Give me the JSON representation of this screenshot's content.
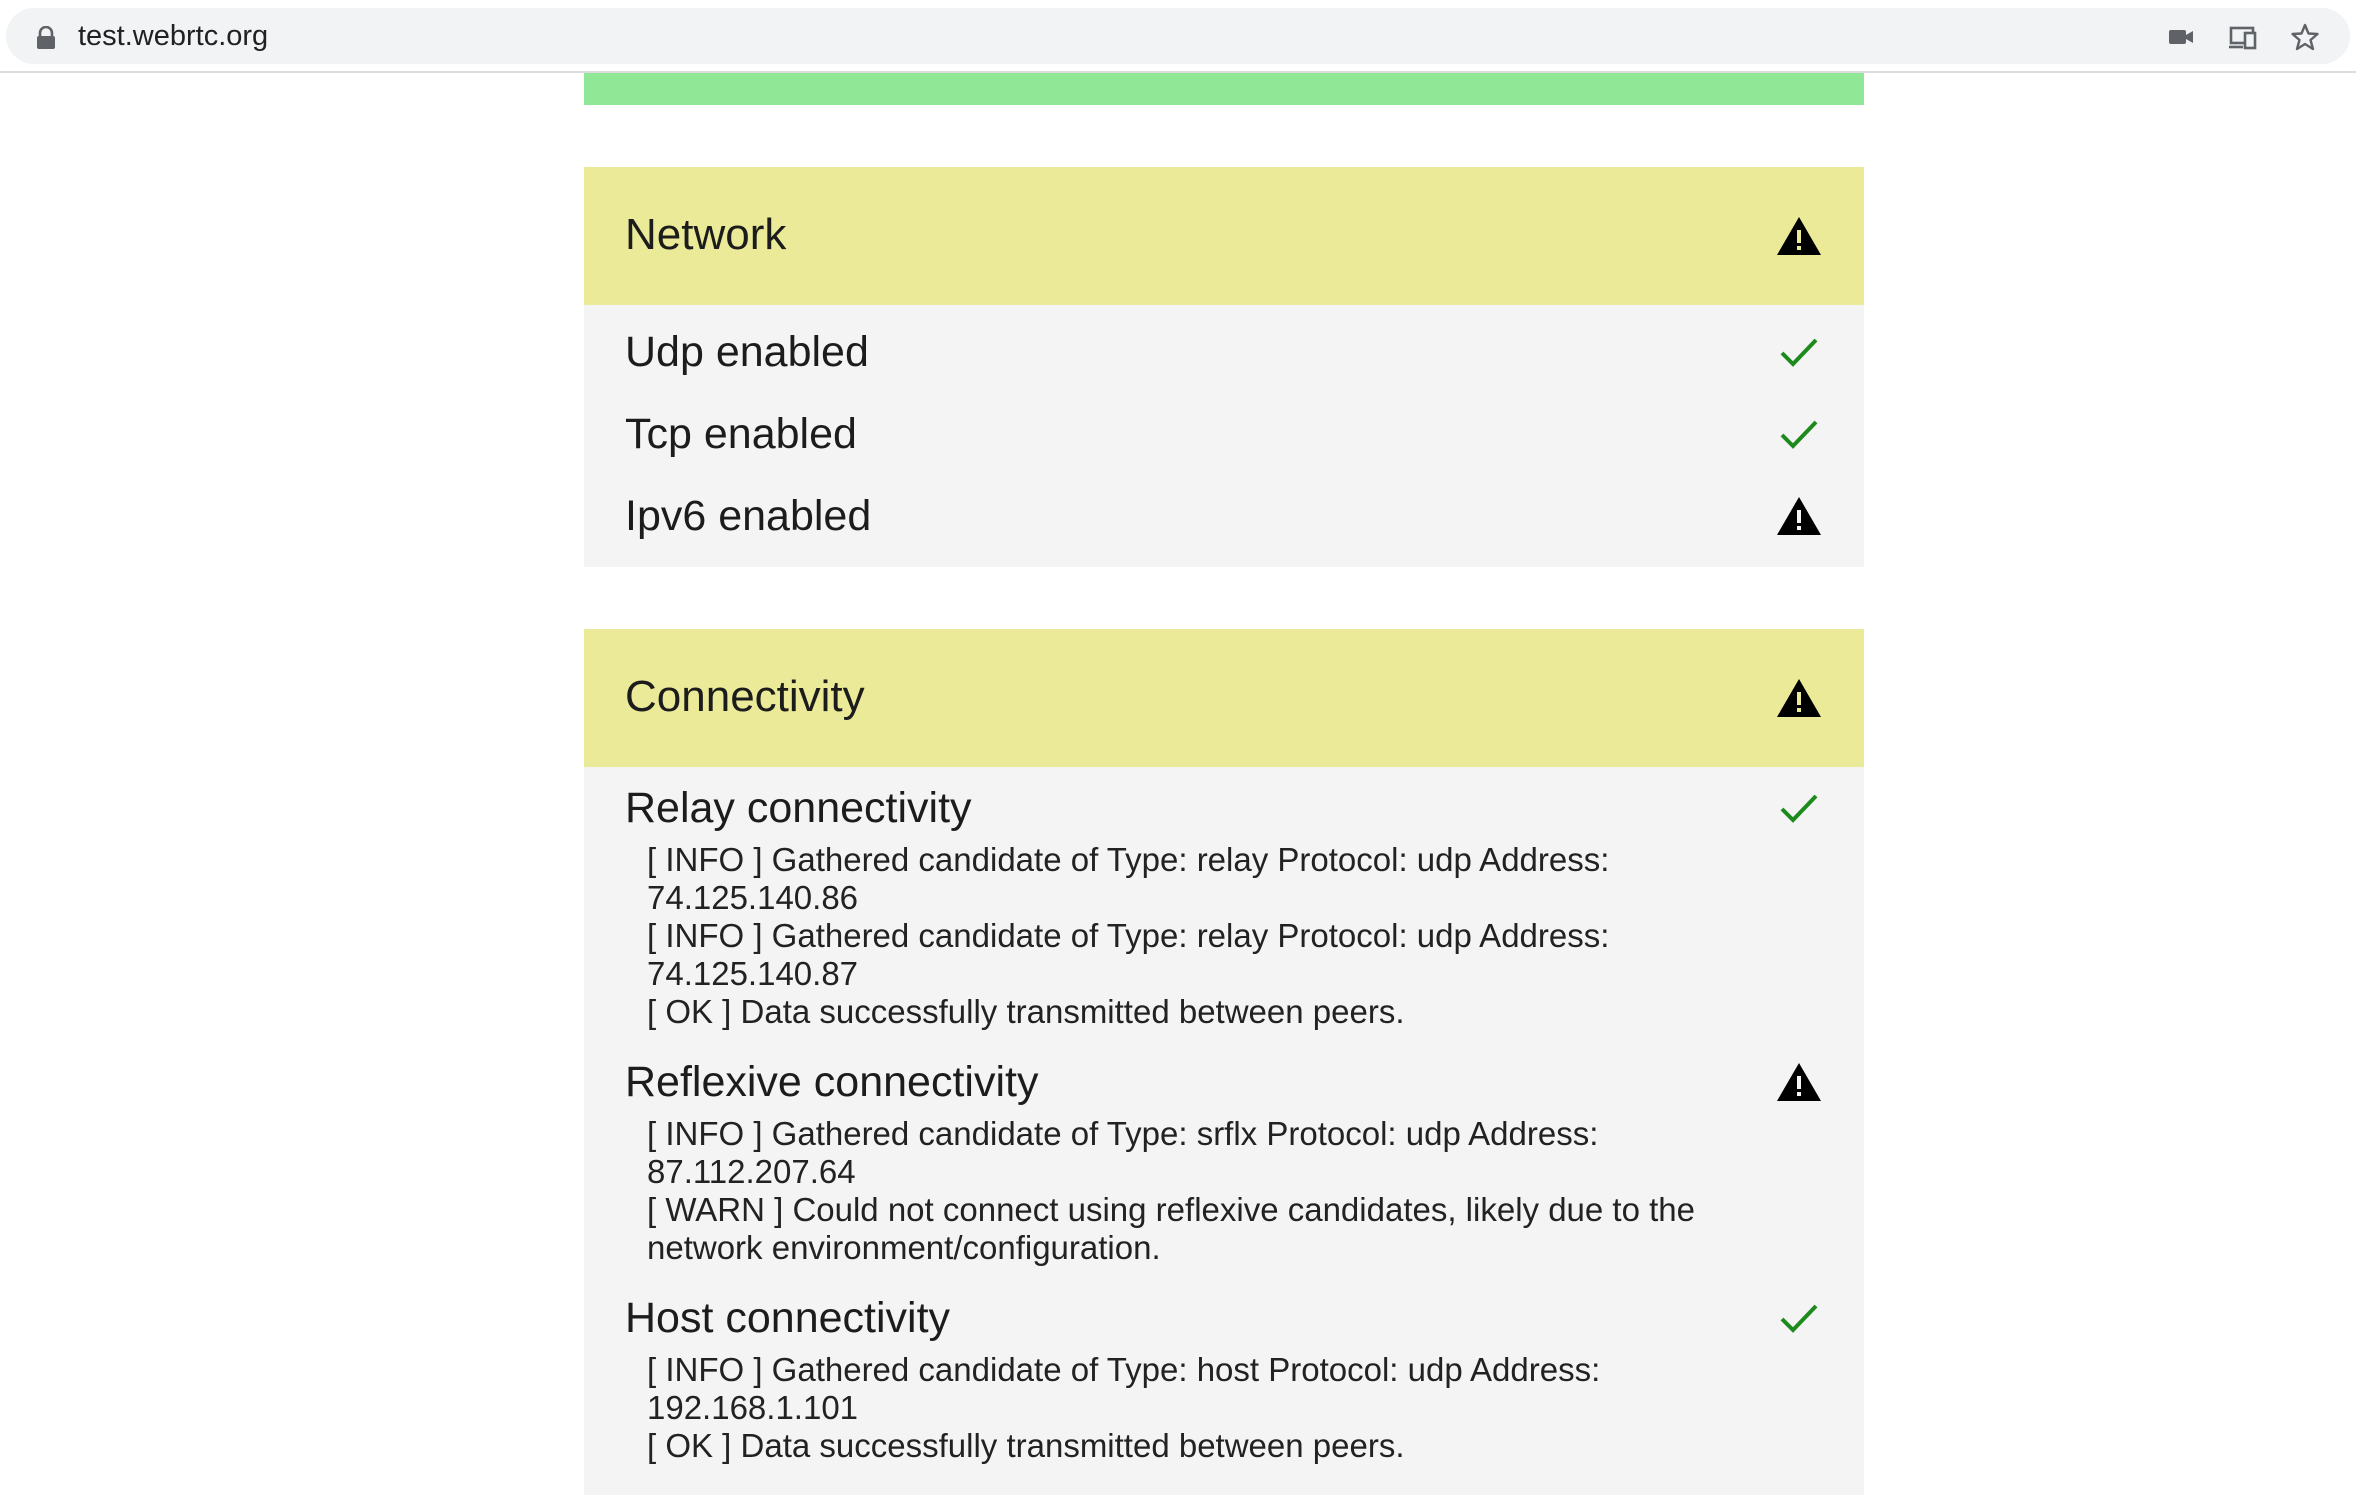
{
  "browser": {
    "url": "test.webrtc.org",
    "icons": [
      "lock-icon",
      "camera-icon",
      "cast-icon",
      "star-icon"
    ]
  },
  "colors": {
    "header_warn": "#ebea98",
    "success_strip": "#90e896",
    "ok": "#1e8a1e",
    "warn": "#000000"
  },
  "network": {
    "title": "Network",
    "status": "warning",
    "items": [
      {
        "label": "Udp enabled",
        "status": "ok"
      },
      {
        "label": "Tcp enabled",
        "status": "ok"
      },
      {
        "label": "Ipv6 enabled",
        "status": "warning"
      }
    ]
  },
  "connectivity": {
    "title": "Connectivity",
    "status": "warning",
    "items": [
      {
        "label": "Relay connectivity",
        "status": "ok",
        "log": [
          "[ INFO ] Gathered candidate of Type: relay Protocol: udp Address: 74.125.140.86",
          "[ INFO ] Gathered candidate of Type: relay Protocol: udp Address: 74.125.140.87",
          "[ OK ] Data successfully transmitted between peers."
        ]
      },
      {
        "label": "Reflexive connectivity",
        "status": "warning",
        "log": [
          "[ INFO ] Gathered candidate of Type: srflx Protocol: udp Address: 87.112.207.64",
          "[ WARN ] Could not connect using reflexive candidates, likely due to the network environment/configuration."
        ]
      },
      {
        "label": "Host connectivity",
        "status": "ok",
        "log": [
          "[ INFO ] Gathered candidate of Type: host Protocol: udp Address: 192.168.1.101",
          "[ OK ] Data successfully transmitted between peers."
        ]
      }
    ]
  }
}
